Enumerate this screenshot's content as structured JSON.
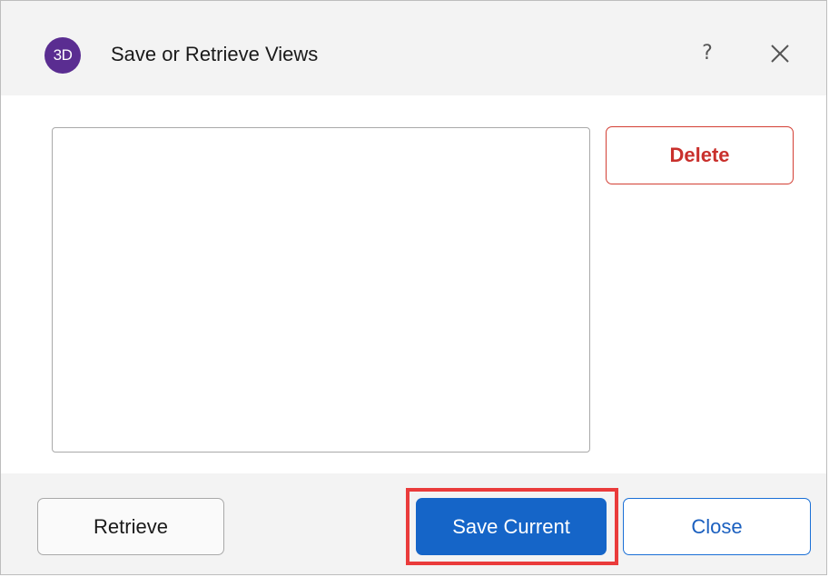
{
  "dialog": {
    "app_icon_text": "3D",
    "app_icon_color": "#5a2d91",
    "title": "Save or Retrieve Views",
    "help_label": "?",
    "close_icon": "close-icon"
  },
  "views_list": {
    "items": []
  },
  "buttons": {
    "delete": "Delete",
    "retrieve": "Retrieve",
    "save_current": "Save Current",
    "close": "Close"
  },
  "colors": {
    "primary": "#1565c8",
    "danger": "#c9302c",
    "highlight": "#ea3b3b"
  }
}
